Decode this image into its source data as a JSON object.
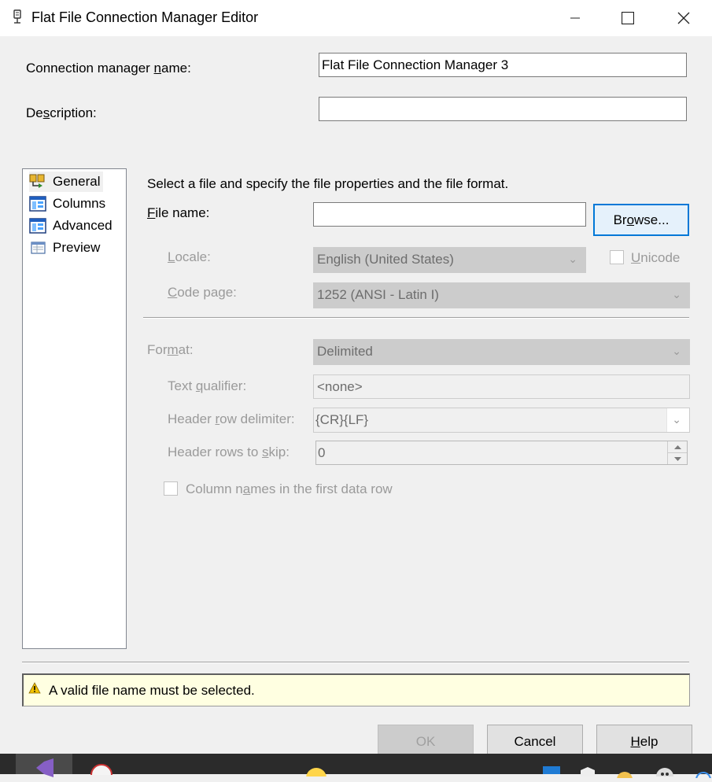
{
  "window": {
    "title": "Flat File Connection Manager Editor",
    "controls": [
      "minimize",
      "maximize",
      "close"
    ]
  },
  "header": {
    "conn_name_label_pre": "Connection manager ",
    "conn_name_label_u": "n",
    "conn_name_label_post": "ame:",
    "conn_name_value": "Flat File Connection Manager 3",
    "desc_label_pre": "De",
    "desc_label_u": "s",
    "desc_label_post": "cription:",
    "desc_value": ""
  },
  "sidebar": {
    "items": [
      {
        "label": "General",
        "icon": "general-icon"
      },
      {
        "label": "Columns",
        "icon": "columns-icon"
      },
      {
        "label": "Advanced",
        "icon": "advanced-icon"
      },
      {
        "label": "Preview",
        "icon": "preview-icon"
      }
    ],
    "selected": "General"
  },
  "general": {
    "instructions": "Select a file and specify the file properties and the file format.",
    "file_label_u": "F",
    "file_label_post": "ile name:",
    "file_value": "",
    "browse_pre": "Br",
    "browse_u": "o",
    "browse_post": "wse...",
    "locale_label_u": "L",
    "locale_label_post": "ocale:",
    "locale_value": "English (United States)",
    "unicode_label_u": "U",
    "unicode_label_post": "nicode",
    "codepage_label_u": "C",
    "codepage_label_post": "ode page:",
    "codepage_value": "1252  (ANSI - Latin I)",
    "format_label_pre": "For",
    "format_label_u": "m",
    "format_label_post": "at:",
    "format_value": "Delimited",
    "text_qualifier_label_pre": "Text ",
    "text_qualifier_label_u": "q",
    "text_qualifier_label_post": "ualifier:",
    "text_qualifier_value": "<none>",
    "header_row_delim_label_pre": "Header ",
    "header_row_delim_label_u": "r",
    "header_row_delim_label_post": "ow delimiter:",
    "header_row_delim_value": "{CR}{LF}",
    "header_rows_skip_label_pre": "Header rows to ",
    "header_rows_skip_label_u": "s",
    "header_rows_skip_label_post": "kip:",
    "header_rows_skip_value": "0",
    "colnames_label_pre": "Column n",
    "colnames_label_u": "a",
    "colnames_label_post": "mes in the first data row"
  },
  "status": {
    "message": "A valid file name must be selected.",
    "icon": "warning-icon"
  },
  "buttons": {
    "ok": "OK",
    "cancel": "Cancel",
    "help_u": "H",
    "help_post": "elp"
  }
}
